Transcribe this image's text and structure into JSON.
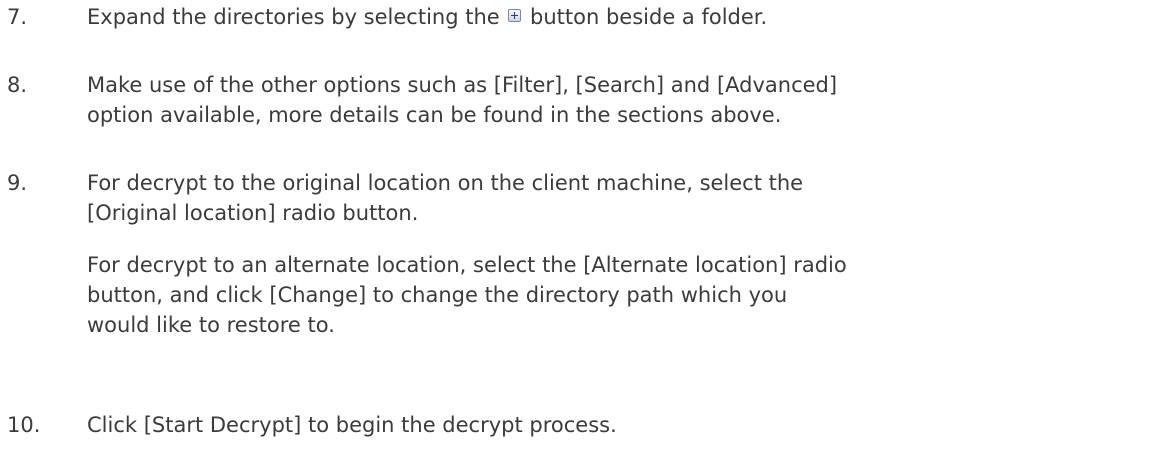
{
  "steps": [
    {
      "number": "7.",
      "before_icon": "Expand the directories by selecting the ",
      "icon": "plus-expand-icon",
      "after_icon": " button beside a folder."
    },
    {
      "number": "8.",
      "line1": "Make use of the other options such as [Filter], [Search] and [Advanced]",
      "line2": "option available, more details can be found in the sections above."
    },
    {
      "number": "9.",
      "line1": "For decrypt to the original location on the client machine, select the",
      "line2": "[Original location] radio button.",
      "followup_line1": "For decrypt to an alternate location, select the [Alternate location] radio",
      "followup_line2": "button, and click [Change] to change the directory path which you",
      "followup_line3": "would like to restore to."
    },
    {
      "number": "10.",
      "line1": "Click [Start Decrypt] to begin the decrypt process."
    }
  ]
}
